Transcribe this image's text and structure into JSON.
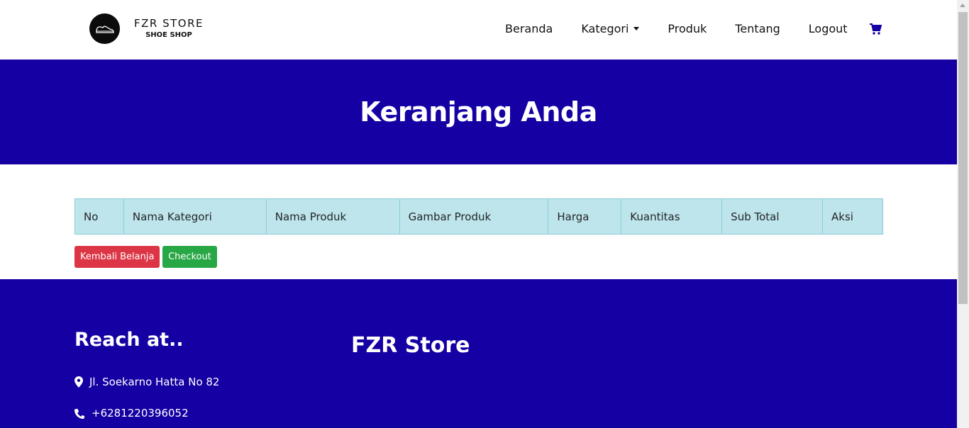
{
  "brand": {
    "title": "FZR STORE",
    "subtitle": "SHOE SHOP"
  },
  "nav": {
    "items": [
      {
        "label": "Beranda"
      },
      {
        "label": "Kategori"
      },
      {
        "label": "Produk"
      },
      {
        "label": "Tentang"
      },
      {
        "label": "Logout"
      }
    ],
    "cart_icon": "shopping-cart-icon"
  },
  "hero": {
    "title": "Keranjang Anda"
  },
  "cart_table": {
    "headers": [
      "No",
      "Nama Kategori",
      "Nama Produk",
      "Gambar Produk",
      "Harga",
      "Kuantitas",
      "Sub Total",
      "Aksi"
    ],
    "rows": []
  },
  "actions": {
    "back_label": "Kembali Belanja",
    "checkout_label": "Checkout"
  },
  "footer": {
    "reach_title": "Reach at..",
    "store_title": "FZR Store",
    "address": "Jl. Soekarno Hatta No 82",
    "phone": "+6281220396052"
  },
  "colors": {
    "primary": "#1400a3",
    "table_header": "#bee5eb",
    "danger": "#dc3545",
    "success": "#28a745"
  }
}
